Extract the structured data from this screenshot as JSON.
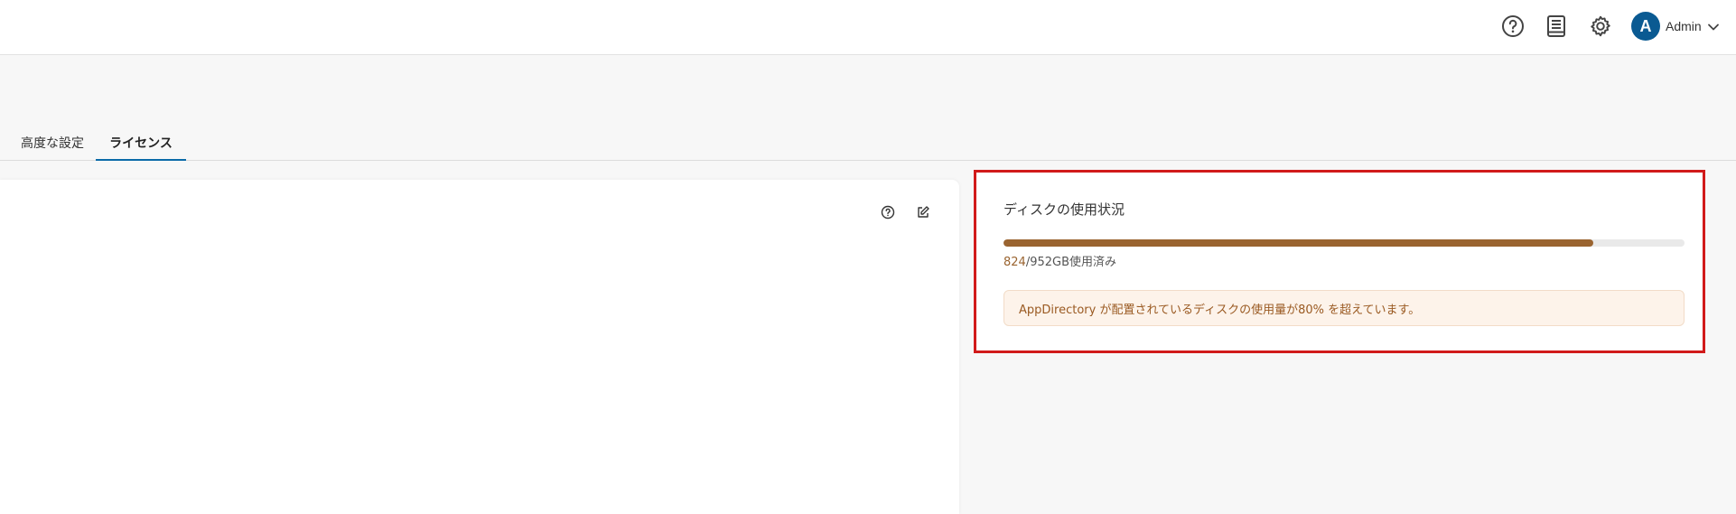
{
  "header": {
    "user": {
      "initial": "A",
      "name": "Admin"
    },
    "icons": [
      "help-circle-icon",
      "book-icon",
      "gear-icon",
      "chevron-down-icon"
    ]
  },
  "tabs": [
    {
      "label": "高度な設定",
      "active": false
    },
    {
      "label": "ライセンス",
      "active": true
    }
  ],
  "disk_usage": {
    "title": "ディスクの使用状況",
    "used": "824",
    "total_label": "/952GB使用済み",
    "used_fraction": 0.8655,
    "warning": "AppDirectory が配置されているディスクの使用量が80% を超えています。"
  },
  "colors": {
    "accent": "#0a6aa8",
    "avatar": "#0a5a92",
    "usage_bar": "#9a6430",
    "warning_bg": "#fdf3ea",
    "highlight_border": "#d11a1a"
  }
}
